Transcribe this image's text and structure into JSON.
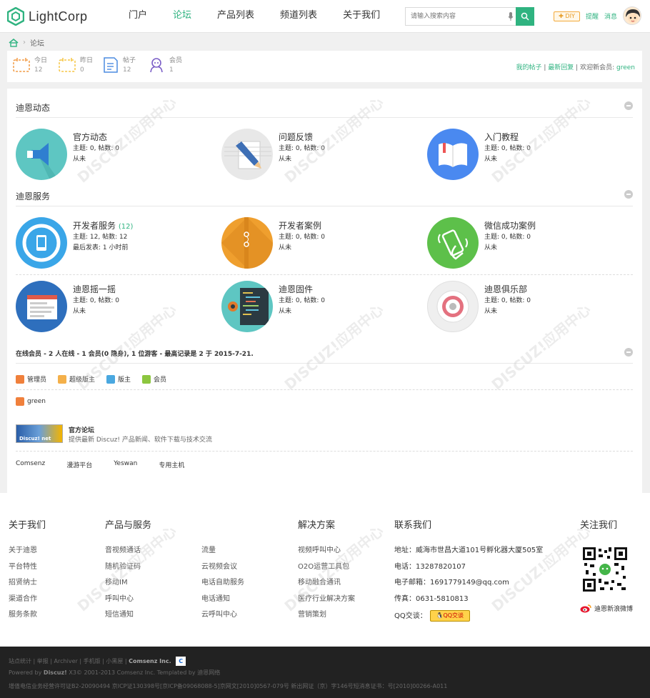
{
  "header": {
    "logo": "LightCorp",
    "nav": [
      "门户",
      "论坛",
      "产品列表",
      "频道列表",
      "关于我们"
    ],
    "search_placeholder": "请输入搜索内容",
    "diy": "DIY",
    "remind": "提醒",
    "message": "消息"
  },
  "breadcrumb": {
    "current": "论坛"
  },
  "stats": {
    "items": [
      {
        "label": "今日",
        "value": "12",
        "color": "#f29b45"
      },
      {
        "label": "昨日",
        "value": "0",
        "color": "#f6c645"
      },
      {
        "label": "帖子",
        "value": "12",
        "color": "#4c8be0"
      },
      {
        "label": "会员",
        "value": "1",
        "color": "#7b5ec7"
      }
    ],
    "my_posts": "我的帖子",
    "latest_reply": "最新回复",
    "welcome": "欢迎新会员:",
    "new_member": "green"
  },
  "sections": [
    {
      "title": "迪恩动态",
      "forums": [
        {
          "title": "官方动态",
          "today": "",
          "meta1": "主题: 0, 帖数: 0",
          "meta2": "从未",
          "icon": "megaphone-icon",
          "color": "#5ec6c2"
        },
        {
          "title": "问题反馈",
          "today": "",
          "meta1": "主题: 0, 帖数: 0",
          "meta2": "从未",
          "icon": "pencil-icon",
          "color": "#e8e8e8"
        },
        {
          "title": "入门教程",
          "today": "",
          "meta1": "主题: 0, 帖数: 0",
          "meta2": "从未",
          "icon": "book-icon",
          "color": "#4a89f0"
        }
      ]
    },
    {
      "title": "迪恩服务",
      "forums": [
        {
          "title": "开发者服务",
          "today": "(12)",
          "meta1": "主题: 12, 帖数: 12",
          "meta2": "最后发表: 1 小时前",
          "icon": "phone-icon",
          "color": "#3aa6e8"
        },
        {
          "title": "开发者案例",
          "today": "",
          "meta1": "主题: 0, 帖数: 0",
          "meta2": "从未",
          "icon": "folder-icon",
          "color": "#ef9f2e"
        },
        {
          "title": "微信成功案例",
          "today": "",
          "meta1": "主题: 0, 帖数: 0",
          "meta2": "从未",
          "icon": "shake-phone-icon",
          "color": "#5dc04a"
        },
        {
          "title": "迪恩摇一摇",
          "today": "",
          "meta1": "主题: 0, 帖数: 0",
          "meta2": "从未",
          "icon": "browser-icon",
          "color": "#2e6fbd"
        },
        {
          "title": "迪恩固件",
          "today": "",
          "meta1": "主题: 0, 帖数: 0",
          "meta2": "从未",
          "icon": "code-icon",
          "color": "#5ec6c2"
        },
        {
          "title": "迪恩俱乐部",
          "today": "",
          "meta1": "主题: 0, 帖数: 0",
          "meta2": "从未",
          "icon": "target-icon",
          "color": "#efefef"
        }
      ]
    }
  ],
  "online": {
    "text": "在线会员 - 2 人在线 - 1 会员(0 隐身), 1 位游客 - 最高记录是 2 于 2015-7-21.",
    "legend": [
      {
        "label": "管理员",
        "color": "#f0803c"
      },
      {
        "label": "超级版主",
        "color": "#f4b04a"
      },
      {
        "label": "版主",
        "color": "#4aa8e0"
      },
      {
        "label": "会员",
        "color": "#8cc63f"
      }
    ],
    "members": [
      "green"
    ]
  },
  "friend_link": {
    "image_text": "Discuz! net",
    "title": "官方论坛",
    "desc": "提供最新 Discuz! 产品新闻、软件下载与技术交流",
    "text_links": [
      "Comsenz",
      "漫游平台",
      "Yeswan",
      "专用主机"
    ]
  },
  "footer": {
    "about": {
      "title": "关于我们",
      "items": [
        "关于迪恩",
        "平台特性",
        "招贤纳士",
        "渠道合作",
        "服务条款"
      ]
    },
    "products": {
      "title": "产品与服务",
      "col1": [
        "音视频通话",
        "随机验证码",
        "移动IM",
        "呼叫中心",
        "短信通知"
      ],
      "col2": [
        "流量",
        "云视频会议",
        "电话自助服务",
        "电话通知",
        "云呼叫中心"
      ]
    },
    "solutions": {
      "title": "解决方案",
      "items": [
        "视频呼叫中心",
        "O2O运营工具包",
        "移动融合通讯",
        "医疗行业解决方案",
        "营销策划"
      ]
    },
    "contact": {
      "title": "联系我们",
      "address": "地址：威海市世昌大道101号孵化器大厦505室",
      "phone": "电话：13287820107",
      "email": "电子邮箱：1691779149@qq.com",
      "fax": "传真：0631-5810813",
      "qq_label": "QQ交谈：",
      "qq_button": "QQ交谈"
    },
    "follow": {
      "title": "关注我们",
      "weibo": "迪恩新浪微博"
    }
  },
  "bottom": {
    "links": "站点统计 | 举报 | Archiver | 手机版 | 小黑屋 |",
    "company": "Comsenz Inc.",
    "powered_prefix": "Powered by",
    "powered_brand": "Discuz!",
    "powered_rest": "X3© 2001-2013 Comsenz Inc.  Templated by 迪恩网络",
    "license": "增值电信业务经营许可证B2-20090494 京ICP证130398号[京ICP备09068088-5]京网文[2010]0567-079号 新出网证（京）字146号短消息证书：号[2010]00266-A011"
  }
}
